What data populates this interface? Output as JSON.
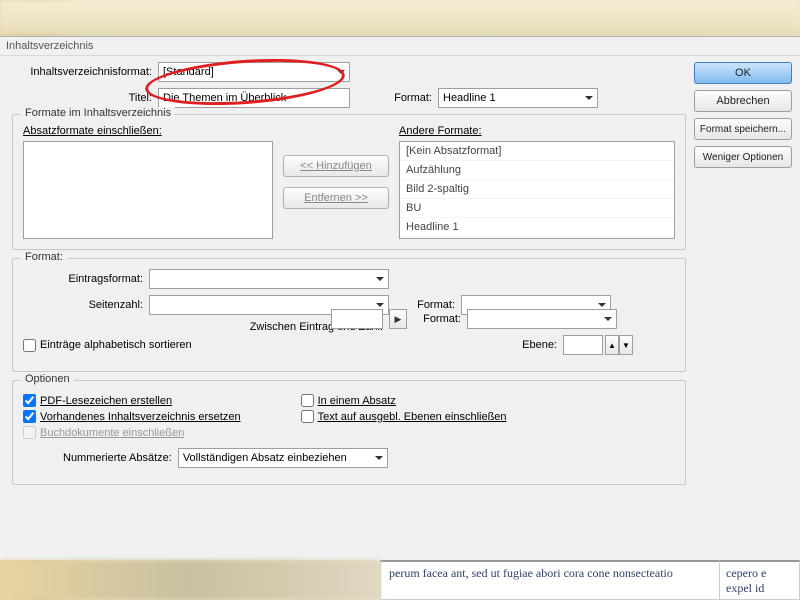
{
  "dialog": {
    "title": "Inhaltsverzeichnis",
    "buttons": {
      "ok": "OK",
      "cancel": "Abbrechen",
      "save_format": "Format speichern...",
      "fewer_options": "Weniger Optionen"
    },
    "toc_format": {
      "label": "Inhaltsverzeichnisformat:",
      "value": "[Standard]"
    },
    "title_field": {
      "label": "Titel:",
      "value": "Die Themen im Überblick"
    },
    "title_format": {
      "label": "Format:",
      "value": "Headline 1"
    },
    "formats_group": {
      "title": "Formate im Inhaltsverzeichnis",
      "include_label": "Absatzformate einschließen:",
      "other_label": "Andere Formate:",
      "add_btn": "<< Hinzufügen",
      "remove_btn": "Entfernen >>",
      "other_items": [
        "[Kein Absatzformat]",
        "Aufzählung",
        "Bild 2-spaltig",
        "BU",
        "Headline 1"
      ]
    },
    "format_group": {
      "title": "Format:",
      "entry_format": "Eintragsformat:",
      "page_num": "Seitenzahl:",
      "between": "Zwischen Eintrag und Zahl:",
      "between_value": "",
      "format_lbl": "Format:",
      "level_lbl": "Ebene:",
      "level_value": "",
      "sort_alpha": "Einträge alphabetisch sortieren"
    },
    "options_group": {
      "title": "Optionen",
      "pdf_bookmarks": "PDF-Lesezeichen erstellen",
      "replace_toc": "Vorhandenes Inhaltsverzeichnis ersetzen",
      "include_books": "Buchdokumente einschließen",
      "single_para": "In einem Absatz",
      "hidden_layers": "Text auf ausgebl. Ebenen einschließen",
      "numbered_para_label": "Nummerierte Absätze:",
      "numbered_para_value": "Vollständigen Absatz einbeziehen"
    }
  },
  "footer": {
    "mid_text": "perum facea ant, sed ut fugiae abori cora cone nonsecteatio",
    "right_text": "cepero e expel id"
  }
}
